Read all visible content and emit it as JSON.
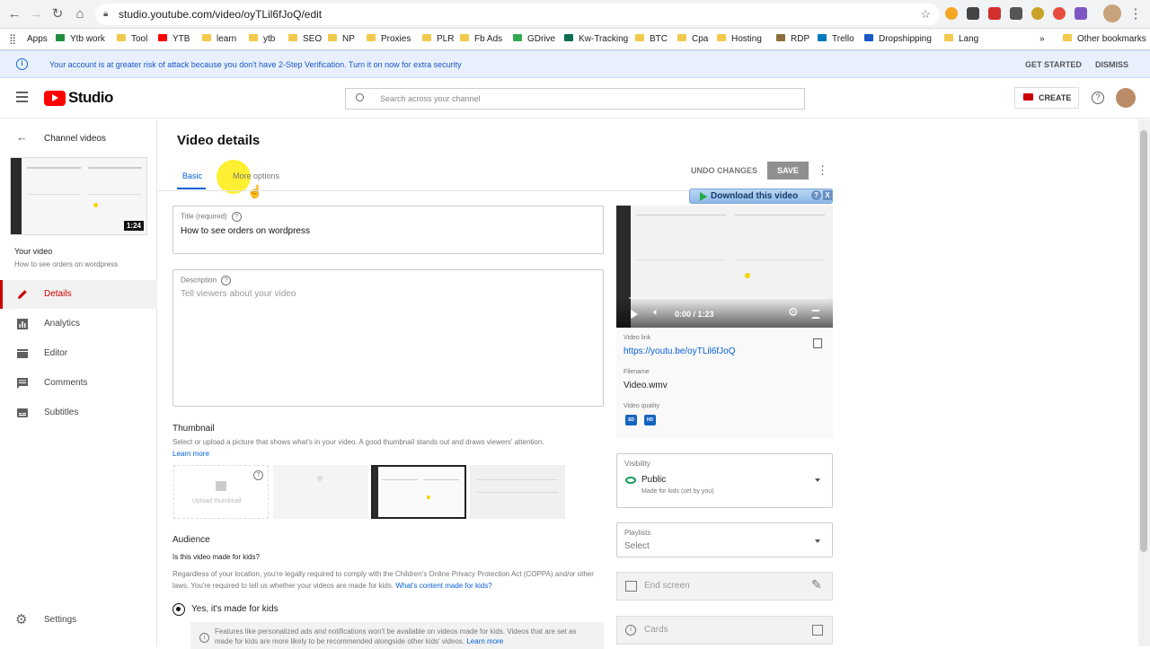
{
  "browser": {
    "url": "studio.youtube.com/video/oyTLil6fJoQ/edit",
    "bookmarks": [
      "Apps",
      "Ytb work",
      "Tool",
      "YTB",
      "learn",
      "ytb",
      "SEO",
      "NP",
      "Proxies",
      "PLR",
      "Fb Ads",
      "GDrive",
      "Kw-Tracking",
      "BTC",
      "Cpa",
      "Hosting",
      "RDP",
      "Trello",
      "Dropshipping",
      "Lang"
    ],
    "more_bookmarks": "»",
    "other_bookmarks": "Other bookmarks"
  },
  "alert": {
    "message": "Your account is at greater risk of attack because you don't have 2-Step Verification. Turn it on now for extra security",
    "get_started": "GET STARTED",
    "dismiss": "DISMISS"
  },
  "header": {
    "logo_text": "Studio",
    "search_placeholder": "Search across your channel",
    "create_label": "CREATE"
  },
  "sidebar": {
    "back_label": "Channel videos",
    "thumb_duration": "1:24",
    "your_video_label": "Your video",
    "your_video_title": "How to see orders on wordpress",
    "items": [
      {
        "label": "Details",
        "icon": "pencil-icon",
        "active": true
      },
      {
        "label": "Analytics",
        "icon": "analytics-icon",
        "active": false
      },
      {
        "label": "Editor",
        "icon": "editor-icon",
        "active": false
      },
      {
        "label": "Comments",
        "icon": "comments-icon",
        "active": false
      },
      {
        "label": "Subtitles",
        "icon": "subtitles-icon",
        "active": false
      }
    ],
    "settings_label": "Settings"
  },
  "main": {
    "page_title": "Video details",
    "tabs": [
      {
        "label": "Basic",
        "active": true
      },
      {
        "label": "More options",
        "active": false
      }
    ],
    "undo_label": "UNDO CHANGES",
    "save_label": "SAVE",
    "title_field": {
      "label": "Title (required)",
      "value": "How to see orders on wordpress"
    },
    "description_field": {
      "label": "Description",
      "placeholder": "Tell viewers about your video"
    },
    "thumbnail": {
      "heading": "Thumbnail",
      "desc": "Select or upload a picture that shows what's in your video. A good thumbnail stands out and draws viewers' attention.",
      "learn_more": "Learn more",
      "upload_label": "Upload thumbnail"
    },
    "audience": {
      "heading": "Audience",
      "question": "Is this video made for kids?",
      "desc": "Regardless of your location, you're legally required to comply with the Children's Online Privacy Protection Act (COPPA) and/or other laws. You're required to tell us whether your videos are made for kids.",
      "link": "What's content made for kids?",
      "option_yes": "Yes, it's made for kids",
      "note": "Features like personalized ads and notifications won't be available on videos made for kids. Videos that are set as made for kids are more likely to be recommended alongside other kids' videos.",
      "note_link": "Learn more"
    }
  },
  "right": {
    "download_label": "Download this video",
    "download_help": "?",
    "download_close": "X",
    "time": "0:00 / 1:23",
    "video_link_label": "Video link",
    "video_link": "https://youtu.be/oyTLil6fJoQ",
    "filename_label": "Filename",
    "filename": "Video.wmv",
    "quality_label": "Video quality",
    "quality_badges": [
      "SD",
      "HD"
    ],
    "visibility_label": "Visibility",
    "visibility_value": "Public",
    "visibility_sub": "Made for kids (set by you)",
    "playlists_label": "Playlists",
    "playlists_value": "Select",
    "end_screen_label": "End screen",
    "cards_label": "Cards"
  },
  "colors": {
    "accent": "#065fd4",
    "brand_red": "#ff0000",
    "active_red": "#cc0000",
    "alert_bg": "#e8f0fe",
    "save_bg": "#909090"
  }
}
